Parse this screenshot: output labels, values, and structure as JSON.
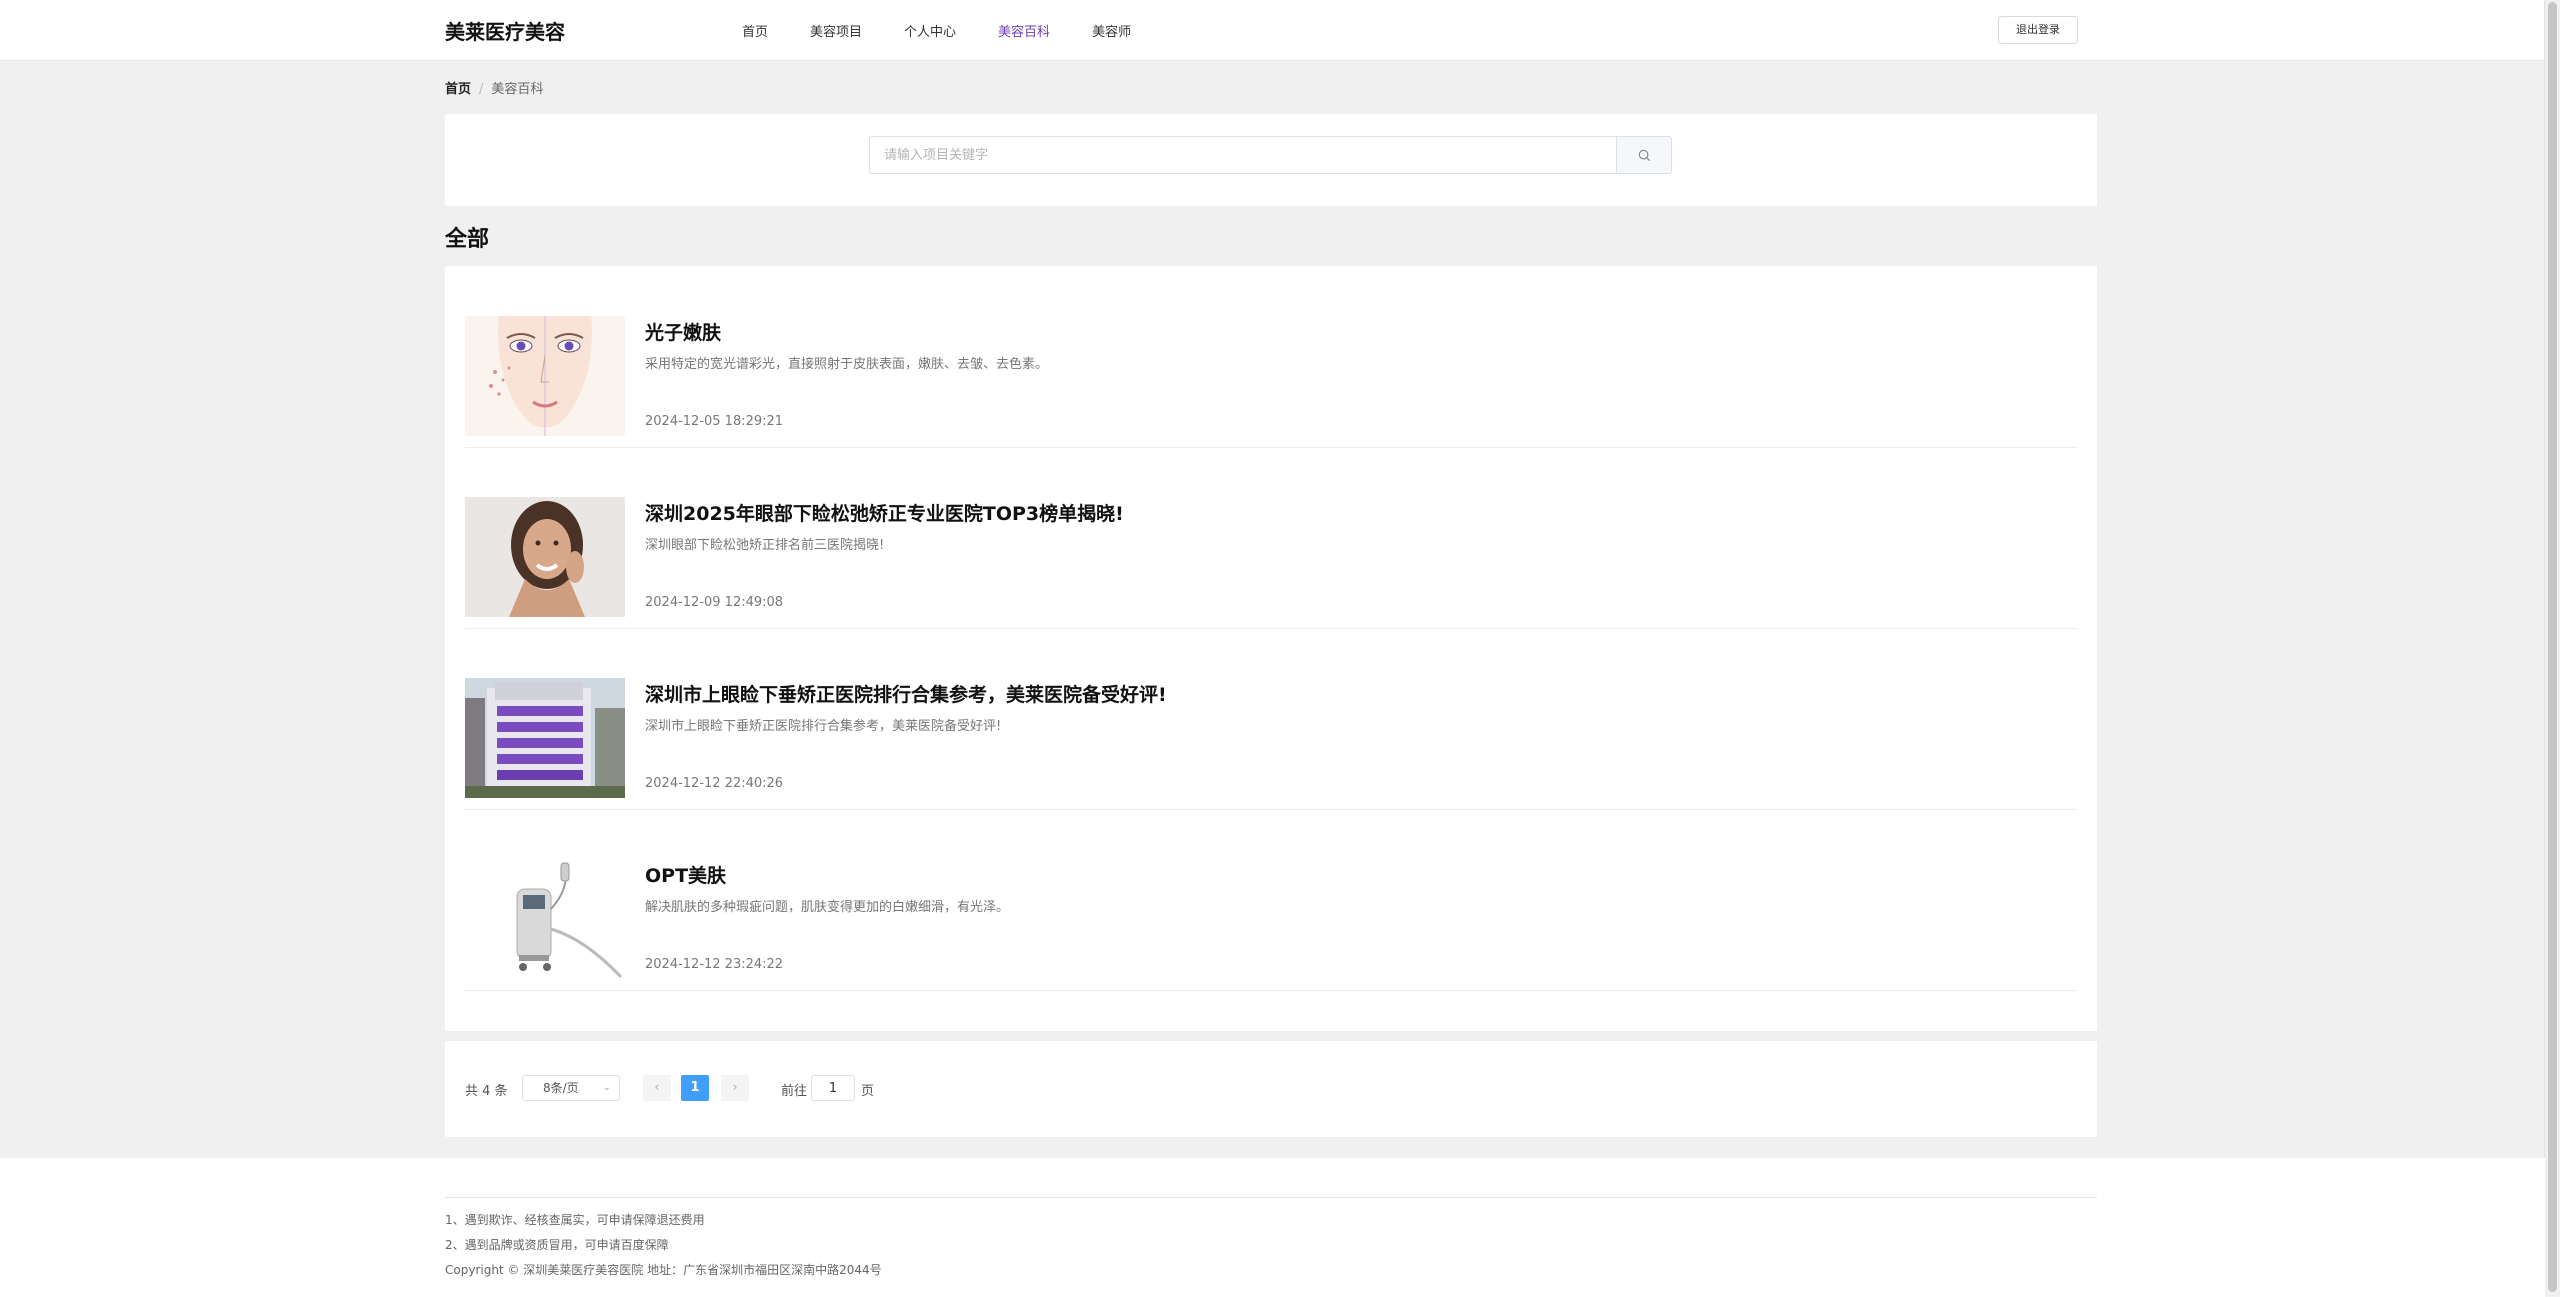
{
  "header": {
    "brand": "美莱医疗美容",
    "nav": [
      "首页",
      "美容项目",
      "个人中心",
      "美容百科",
      "美容师"
    ],
    "active_nav": "美容百科",
    "logout": "退出登录"
  },
  "breadcrumb": {
    "home": "首页",
    "current": "美容百科"
  },
  "search": {
    "placeholder": "请输入项目关键字",
    "value": ""
  },
  "section": {
    "title": "全部"
  },
  "articles": [
    {
      "title": "光子嫩肤",
      "desc": "采用特定的宽光谱彩光，直接照射于皮肤表面，嫩肤、去皱、去色素。",
      "date": "2024-12-05 18:29:21",
      "image": "face-illustration"
    },
    {
      "title": "深圳2025年眼部下睑松弛矫正专业医院TOP3榜单揭晓!",
      "desc": "深圳眼部下睑松弛矫正排名前三医院揭晓!",
      "date": "2024-12-09 12:49:08",
      "image": "smiling-woman-photo"
    },
    {
      "title": "深圳市上眼睑下垂矫正医院排行合集参考，美莱医院备受好评!",
      "desc": "深圳市上眼睑下垂矫正医院排行合集参考，美莱医院备受好评!",
      "date": "2024-12-12 22:40:26",
      "image": "hospital-building-photo"
    },
    {
      "title": "OPT美肤",
      "desc": "解决肌肤的多种瑕疵问题，肌肤变得更加的白嫩细滑，有光泽。",
      "date": "2024-12-12 23:24:22",
      "image": "opt-machine-photo"
    }
  ],
  "pagination": {
    "total": "共 4 条",
    "page_size": "8条/页",
    "current_page": "1",
    "goto_label": "前往",
    "goto_value": "1",
    "page_suffix": "页"
  },
  "footer": {
    "line1": "1、遇到欺诈、经核查属实，可申请保障退还费用",
    "line2": "2、遇到品牌或资质冒用，可申请百度保障",
    "line3": "Copyright © 深圳美莱医疗美容医院 地址：广东省深圳市福田区深南中路2044号"
  },
  "colors": {
    "accent": "#6c3fb0",
    "pager_active": "#409eff"
  }
}
